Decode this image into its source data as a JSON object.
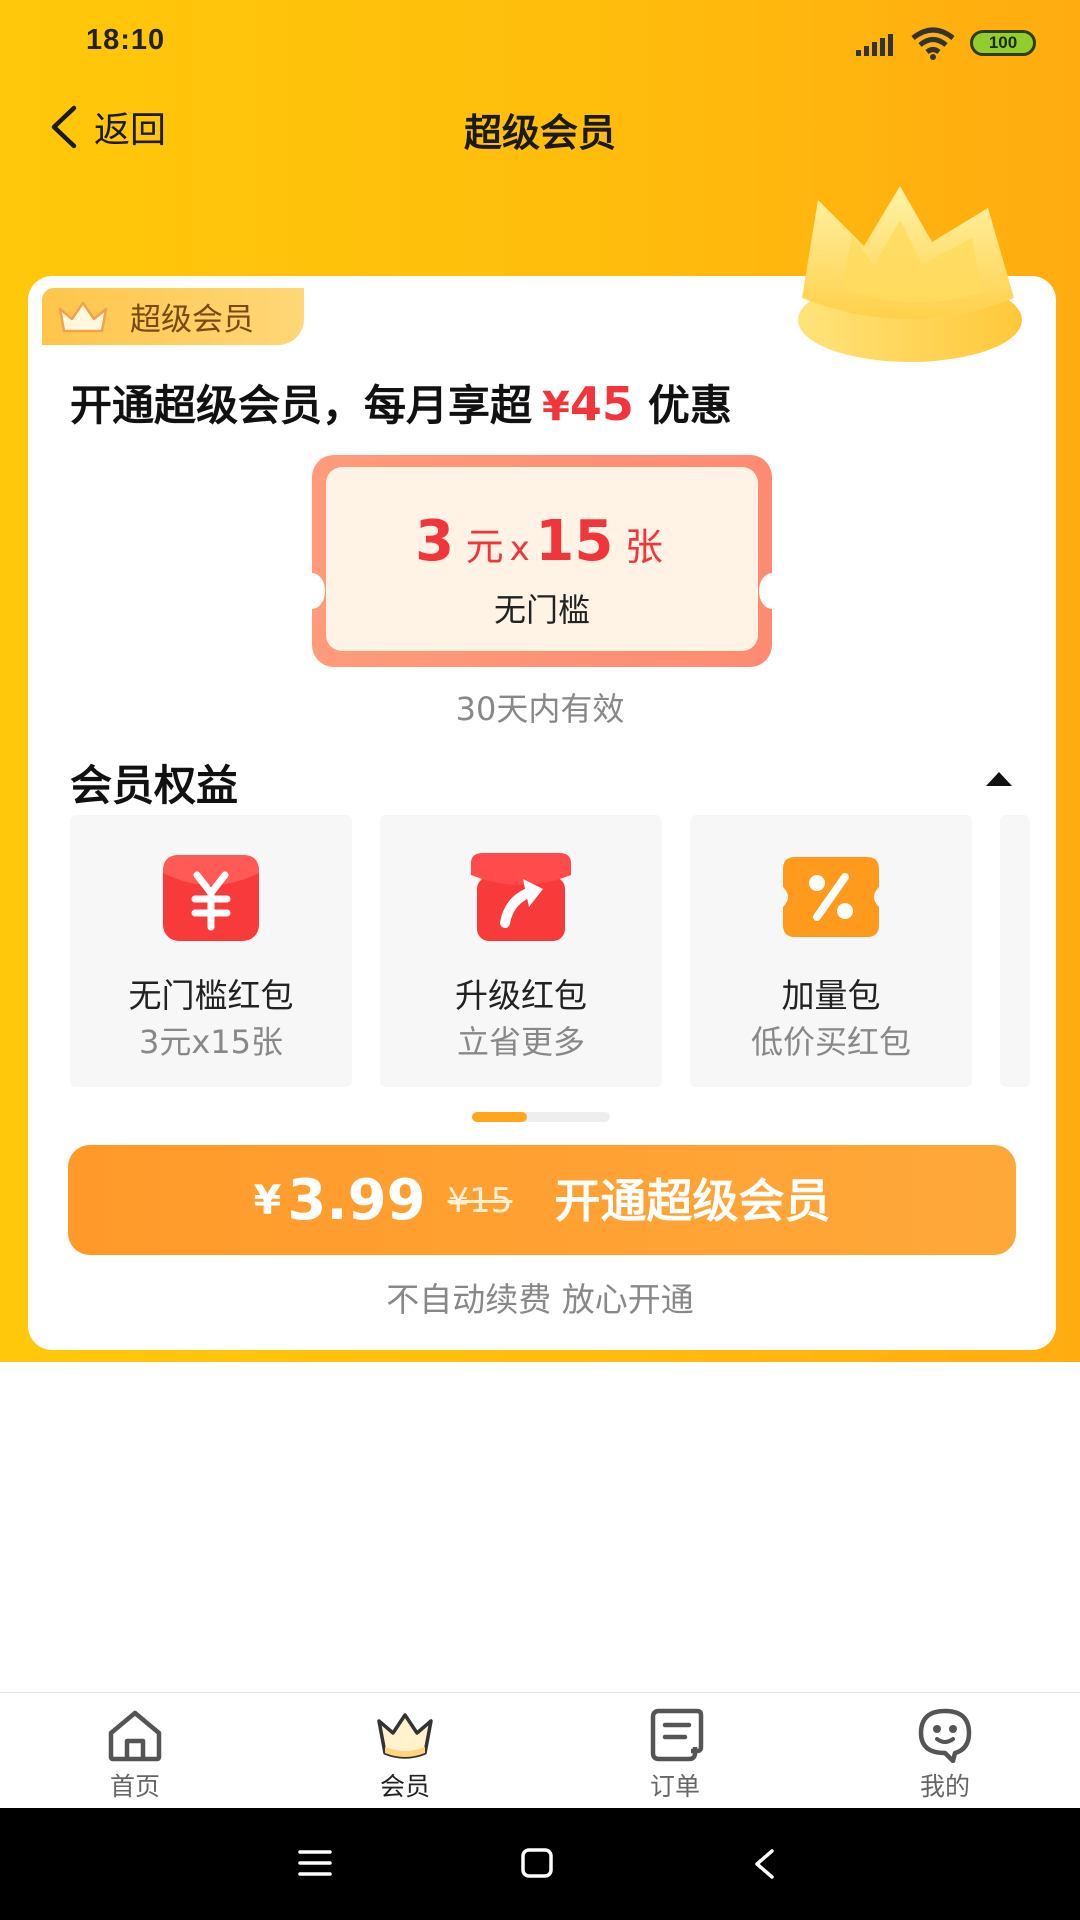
{
  "status_bar": {
    "time": "18:10",
    "battery": "100"
  },
  "header": {
    "back_label": "返回",
    "title": "超级会员"
  },
  "card": {
    "badge": "超级会员",
    "headline_prefix": "开通超级会员，每月享超",
    "headline_currency": "¥",
    "headline_amount": "45",
    "headline_suffix": "优惠",
    "coupon": {
      "value": "3",
      "value_unit": "元",
      "times": "x",
      "count": "15",
      "count_unit": "张",
      "condition": "无门槛"
    },
    "validity": "30天内有效",
    "benefits_title": "会员权益",
    "benefits": [
      {
        "title": "无门槛红包",
        "subtitle": "3元x15张",
        "icon": "red-envelope-yen-icon"
      },
      {
        "title": "升级红包",
        "subtitle": "立省更多",
        "icon": "upgrade-red-envelope-icon"
      },
      {
        "title": "加量包",
        "subtitle": "低价买红包",
        "icon": "percent-coupon-icon"
      }
    ],
    "carousel_progress": 0.4,
    "purchase": {
      "currency": "¥",
      "price": "3.99",
      "original_price": "¥15",
      "label": "开通超级会员"
    },
    "purchase_note": "不自动续费 放心开通"
  },
  "tabbar": [
    {
      "label": "首页",
      "icon": "home-icon",
      "active": false
    },
    {
      "label": "会员",
      "icon": "crown-icon",
      "active": true
    },
    {
      "label": "订单",
      "icon": "order-receipt-icon",
      "active": false
    },
    {
      "label": "我的",
      "icon": "profile-face-icon",
      "active": false
    }
  ],
  "colors": {
    "hero_yellow": "#ffc20c",
    "accent_red": "#f2353b",
    "button_orange": "#ffa030",
    "tab_active": "#222222",
    "tab_inactive": "#666666"
  }
}
